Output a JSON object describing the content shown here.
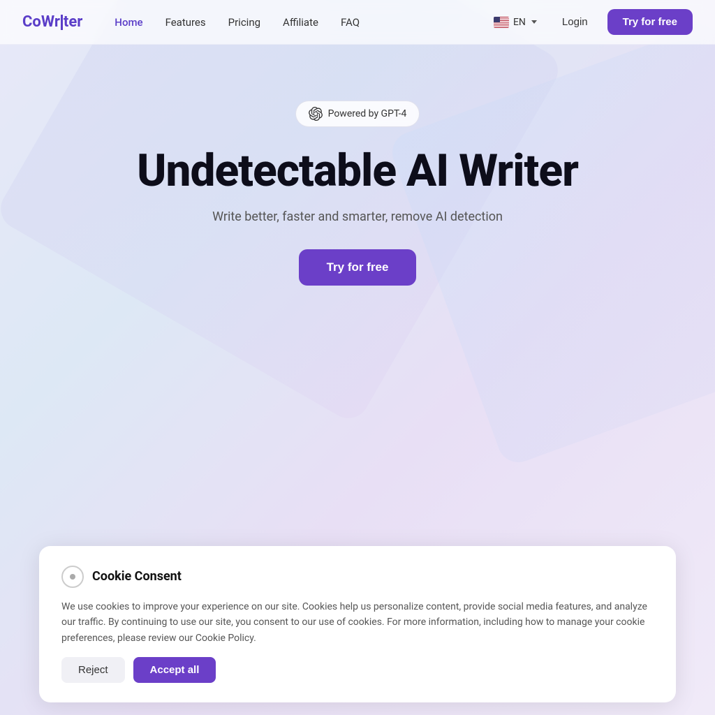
{
  "brand": {
    "name_prefix": "CoWr",
    "name_suffix": "ter",
    "color": "#5b3ec8"
  },
  "nav": {
    "links": [
      {
        "label": "Home",
        "active": true
      },
      {
        "label": "Features",
        "active": false
      },
      {
        "label": "Pricing",
        "active": false
      },
      {
        "label": "Affiliate",
        "active": false
      },
      {
        "label": "FAQ",
        "active": false
      }
    ],
    "lang": "EN",
    "login_label": "Login",
    "try_label": "Try for free"
  },
  "hero": {
    "badge_text": "Powered by GPT-4",
    "title": "Undetectable AI Writer",
    "subtitle": "Write better, faster and smarter, remove AI detection",
    "cta_label": "Try for free"
  },
  "cookie": {
    "title": "Cookie Consent",
    "body": "We use cookies to improve your experience on our site. Cookies help us personalize content, provide social media features, and analyze our traffic. By continuing to use our site, you consent to our use of cookies. For more information, including how to manage your cookie preferences, please review our Cookie Policy.",
    "reject_label": "Reject",
    "accept_label": "Accept all"
  }
}
